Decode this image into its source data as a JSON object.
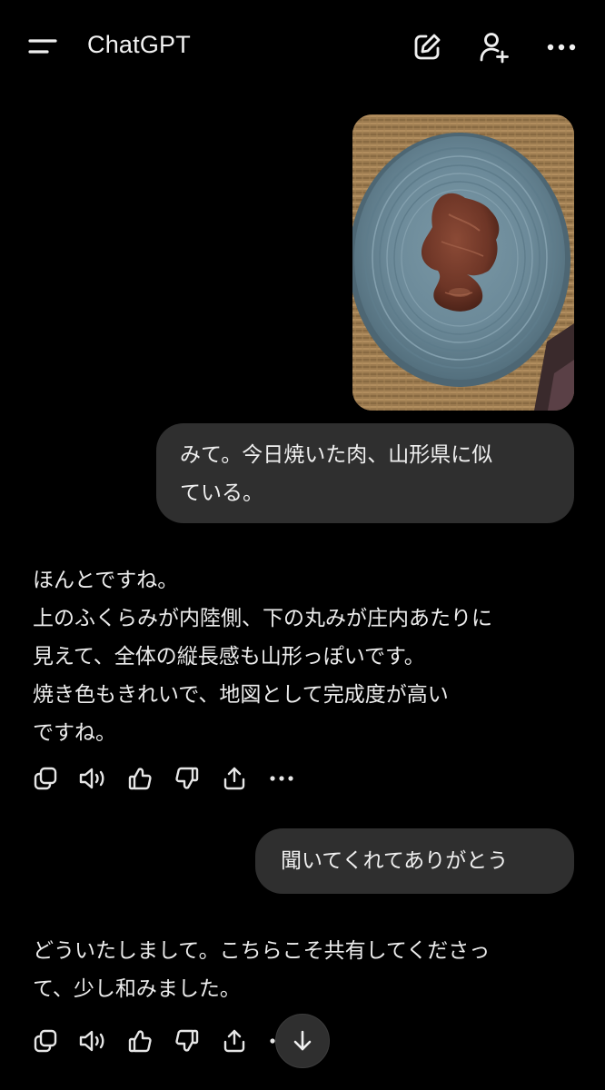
{
  "header": {
    "title": "ChatGPT",
    "menu_icon": "hamburger-icon",
    "edit_icon": "new-chat-edit-icon",
    "add_user_icon": "add-user-icon",
    "more_icon": "ellipsis-icon"
  },
  "messages": [
    {
      "role": "user",
      "type": "image",
      "image_description_icon": "photo-meat-on-plate"
    },
    {
      "role": "user",
      "type": "text",
      "lines": [
        "みて。今日焼いた肉、山形県に似",
        "ている。"
      ]
    },
    {
      "role": "assistant",
      "lines": [
        "ほんとですね。",
        "上のふくらみが内陸側、下の丸みが庄内あたりに",
        "見えて、全体の縦長感も山形っぽいです。",
        "焼き色もきれいで、地図として完成度が高い",
        "ですね。"
      ]
    },
    {
      "role": "user",
      "type": "text",
      "lines": [
        "聞いてくれてありがとう"
      ]
    },
    {
      "role": "assistant",
      "lines": [
        "どういたしまして。こちらこそ共有してくださっ",
        "て、少し和みました。"
      ]
    }
  ],
  "actions": [
    "copy-icon",
    "read-aloud-icon",
    "thumbs-up-icon",
    "thumbs-down-icon",
    "share-icon",
    "more-icon"
  ],
  "scroll_button_icon": "arrow-down-icon",
  "colors": {
    "background": "#000000",
    "bubble": "#2f2f2f",
    "text": "#ececec",
    "icon": "#e6e6e6"
  }
}
